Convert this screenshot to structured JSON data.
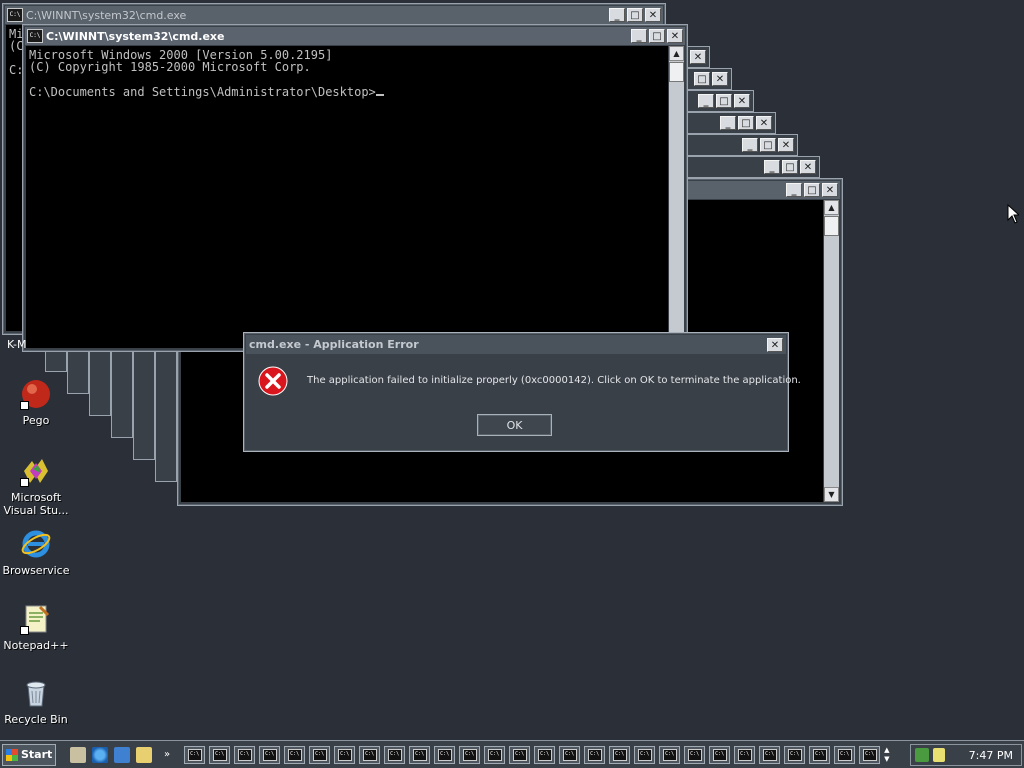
{
  "windows": {
    "back_title": "C:\\WINNT\\system32\\cmd.exe",
    "back_console_lines": [
      "Mi",
      "(C",
      "",
      "C:"
    ],
    "front_title": "C:\\WINNT\\system32\\cmd.exe",
    "front_console": [
      "Microsoft Windows 2000 [Version 5.00.2195]",
      "(C) Copyright 1985-2000 Microsoft Corp.",
      "",
      "C:\\Documents and Settings\\Administrator\\Desktop>"
    ],
    "icon_text": "C:\\",
    "minimize": "_",
    "maximize": "□",
    "close": "✕"
  },
  "partial_label": "K-M",
  "dialog": {
    "title": "cmd.exe - Application Error",
    "message": "The application failed to initialize properly (0xc0000142). Click on OK to terminate the application.",
    "ok": "OK",
    "close": "✕"
  },
  "desktop_icons": [
    {
      "label": "Pego",
      "icon": "pego-icon"
    },
    {
      "label": "Microsoft Visual Stu...",
      "icon": "visual-studio-icon"
    },
    {
      "label": "Browservice",
      "icon": "internet-explorer-icon"
    },
    {
      "label": "Notepad++",
      "icon": "notepad-plus-plus-icon"
    },
    {
      "label": "Recycle Bin",
      "icon": "recycle-bin-icon"
    }
  ],
  "taskbar": {
    "start": "Start",
    "chevron": "»",
    "task_count": 28,
    "clock": "7:47 PM"
  },
  "colors": {
    "desktop": "#2a2f38",
    "error_red": "#d9161d"
  }
}
